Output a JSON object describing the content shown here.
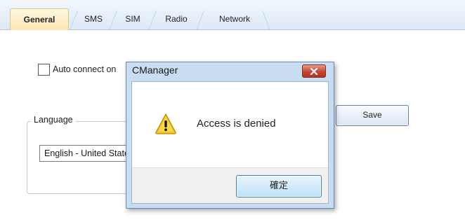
{
  "tabs": [
    {
      "label": "General",
      "active": true
    },
    {
      "label": "SMS",
      "active": false
    },
    {
      "label": "SIM",
      "active": false
    },
    {
      "label": "Radio",
      "active": false
    },
    {
      "label": "Network",
      "active": false
    }
  ],
  "settings": {
    "auto_connect_label": "Auto connect on",
    "auto_connect_checked": false,
    "language_group_label": "Language",
    "language_value": "English - United States",
    "save_label": "Save"
  },
  "dialog": {
    "title": "CManager",
    "message": "Access is denied",
    "icon": "warning-icon",
    "ok_label": "確定"
  },
  "colors": {
    "tabstrip_bg": "#dce9f7",
    "active_tab_bg": "#fbe6b2",
    "dialog_frame": "#c8dcf2",
    "close_button": "#c5462f",
    "warning_yellow": "#f5c518"
  }
}
